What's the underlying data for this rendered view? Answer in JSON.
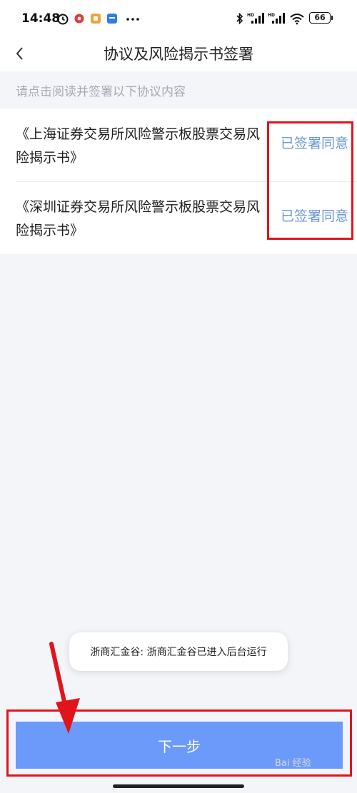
{
  "status_bar": {
    "time": "14:48",
    "battery": "66",
    "left_icons": [
      "alarm-icon",
      "red-circle-app-icon",
      "orange-app-icon",
      "blue-app-icon",
      "more-dots-icon"
    ],
    "right_icons": [
      "bluetooth-icon",
      "hd-signal-icon",
      "hd-signal-icon",
      "wifi-icon",
      "battery-icon"
    ]
  },
  "nav": {
    "title": "协议及风险揭示书签署",
    "back_icon": "chevron-left-icon"
  },
  "subheader": "请点击阅读并签署以下协议内容",
  "agreements": [
    {
      "title": "《上海证券交易所风险警示板股票交易风险揭示书》",
      "status": "已签署同意"
    },
    {
      "title": "《深圳证券交易所风险警示板股票交易风险揭示书》",
      "status": "已签署同意"
    }
  ],
  "toast": "浙商汇金谷: 浙商汇金谷已进入后台运行",
  "next_button": "下一步",
  "watermark": "Bai 经验",
  "colors": {
    "accent_blue": "#6b9afa",
    "link_blue": "#6a97d2",
    "annotation_red": "#e0141b",
    "background": "#f4f5f9"
  }
}
